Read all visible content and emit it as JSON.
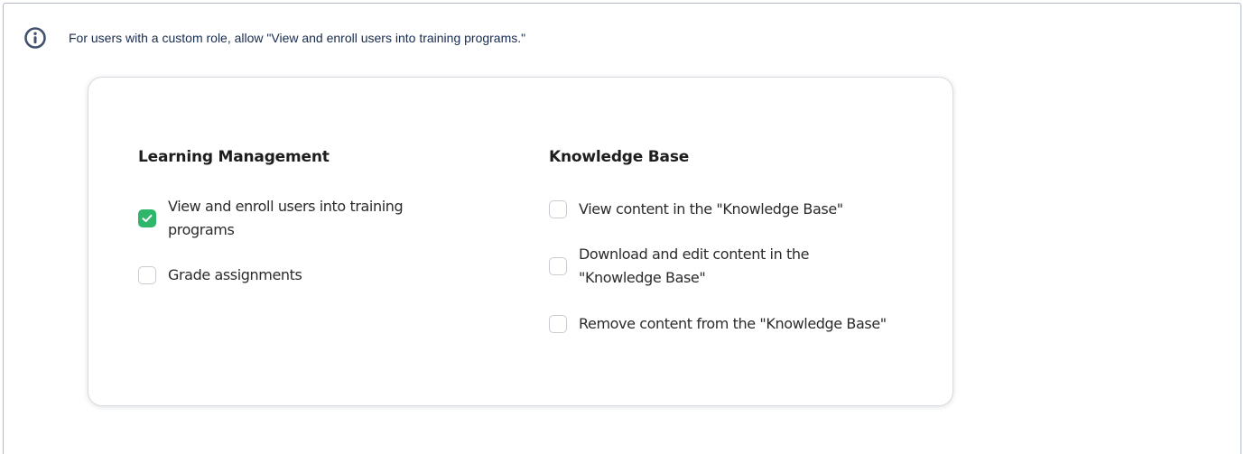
{
  "info": {
    "text": "For users with a custom role, allow \"View and enroll users into training programs.\""
  },
  "colors": {
    "accent": "#2fb66b",
    "info_icon": "#42526e",
    "panel_border": "#b3bac5"
  },
  "permissions": {
    "learning": {
      "title": "Learning Management",
      "items": [
        {
          "label": "View and enroll users into training programs",
          "checked": true
        },
        {
          "label": "Grade assignments",
          "checked": false
        }
      ]
    },
    "knowledge": {
      "title": "Knowledge Base",
      "items": [
        {
          "label": "View content in the \"Knowledge Base\"",
          "checked": false
        },
        {
          "label": "Download and edit content in the \"Knowledge Base\"",
          "checked": false
        },
        {
          "label": "Remove content from the \"Knowledge Base\"",
          "checked": false
        }
      ]
    }
  }
}
